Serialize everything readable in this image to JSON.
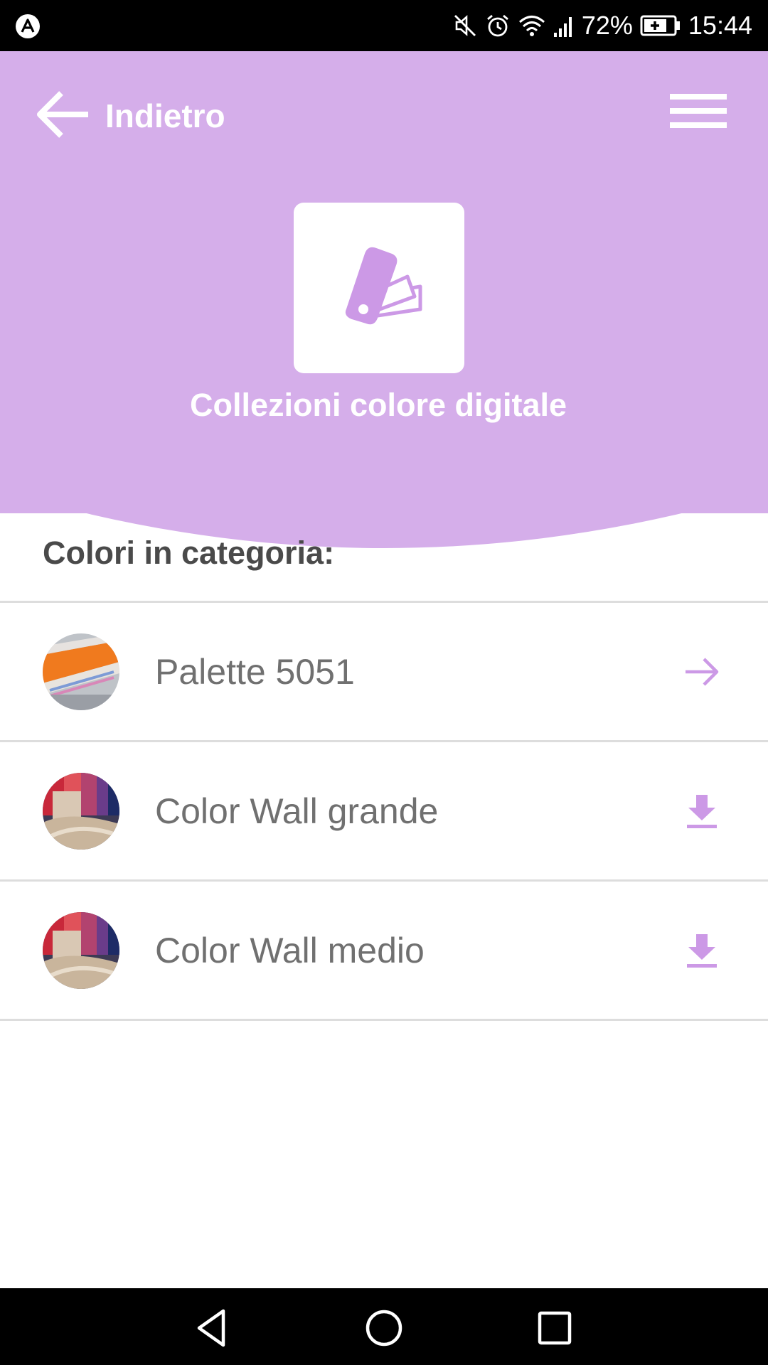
{
  "status_bar": {
    "battery_percent": "72%",
    "time": "15:44",
    "icons": [
      "app-notification-icon",
      "mute-icon",
      "alarm-icon",
      "wifi-icon",
      "signal-icon",
      "battery-charging-icon"
    ]
  },
  "header": {
    "back_label": "Indietro",
    "title": "Collezioni colore digitale",
    "icons": {
      "back": "arrow-left-icon",
      "menu": "hamburger-menu-icon",
      "hero": "color-fan-deck-icon"
    }
  },
  "colors": {
    "accent": "#d5aeea",
    "accent_dark": "#cc99e6",
    "text": "#4a4a4a",
    "muted_text": "#707070"
  },
  "section_title": "Colori in categoria:",
  "list": {
    "items": [
      {
        "label": "Palette 5051",
        "action": "arrow-right-icon"
      },
      {
        "label": "Color Wall grande",
        "action": "download-icon"
      },
      {
        "label": "Color Wall medio",
        "action": "download-icon"
      }
    ]
  },
  "nav_bar": {
    "icons": [
      "back-triangle-icon",
      "home-circle-icon",
      "recents-square-icon"
    ]
  }
}
